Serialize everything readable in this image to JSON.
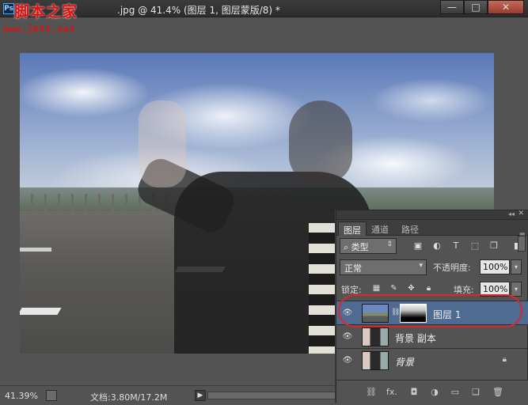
{
  "window": {
    "title": "图层 蒙版 (合成).jpg @ 41.4% (图层 1, 图层蒙版/8) *",
    "title_visible": ".jpg @ 41.4% (图层 1, 图层蒙版/8) *",
    "minimize": "—",
    "maximize": "□",
    "close": "✕"
  },
  "watermark": {
    "title": "脚本之家",
    "url": "www.jb51.net"
  },
  "app_badge": "Ps",
  "statusbar": {
    "zoom": "41.39%",
    "doc_info": "文档:3.80M/17.2M",
    "arrow": "▶"
  },
  "layers_panel": {
    "tabs": [
      {
        "label": "图层",
        "active": true
      },
      {
        "label": "通道",
        "active": false
      },
      {
        "label": "路径",
        "active": false
      }
    ],
    "filter": {
      "label": "⌕ 类型",
      "caret": "⇕"
    },
    "blend_mode": "正常",
    "opacity_label": "不透明度:",
    "opacity_value": "100%",
    "lock_label": "锁定:",
    "fill_label": "填充:",
    "fill_value": "100%",
    "layers": [
      {
        "name": "图层 1",
        "selected": true,
        "has_mask": true
      },
      {
        "name": "背景 副本",
        "selected": false,
        "has_mask": false
      },
      {
        "name": "背景",
        "selected": false,
        "has_mask": false,
        "locked": true
      }
    ],
    "footer_icons": [
      "link-icon",
      "fx-icon",
      "mask-icon",
      "adjustment-icon",
      "folder-icon",
      "new-layer-icon",
      "trash-icon"
    ],
    "footer_fx": "fx."
  },
  "colors": {
    "panel_bg": "#535353",
    "selected_layer": "#4f6b91",
    "highlight_circle": "#d8282e",
    "watermark_red": "#e01010"
  }
}
